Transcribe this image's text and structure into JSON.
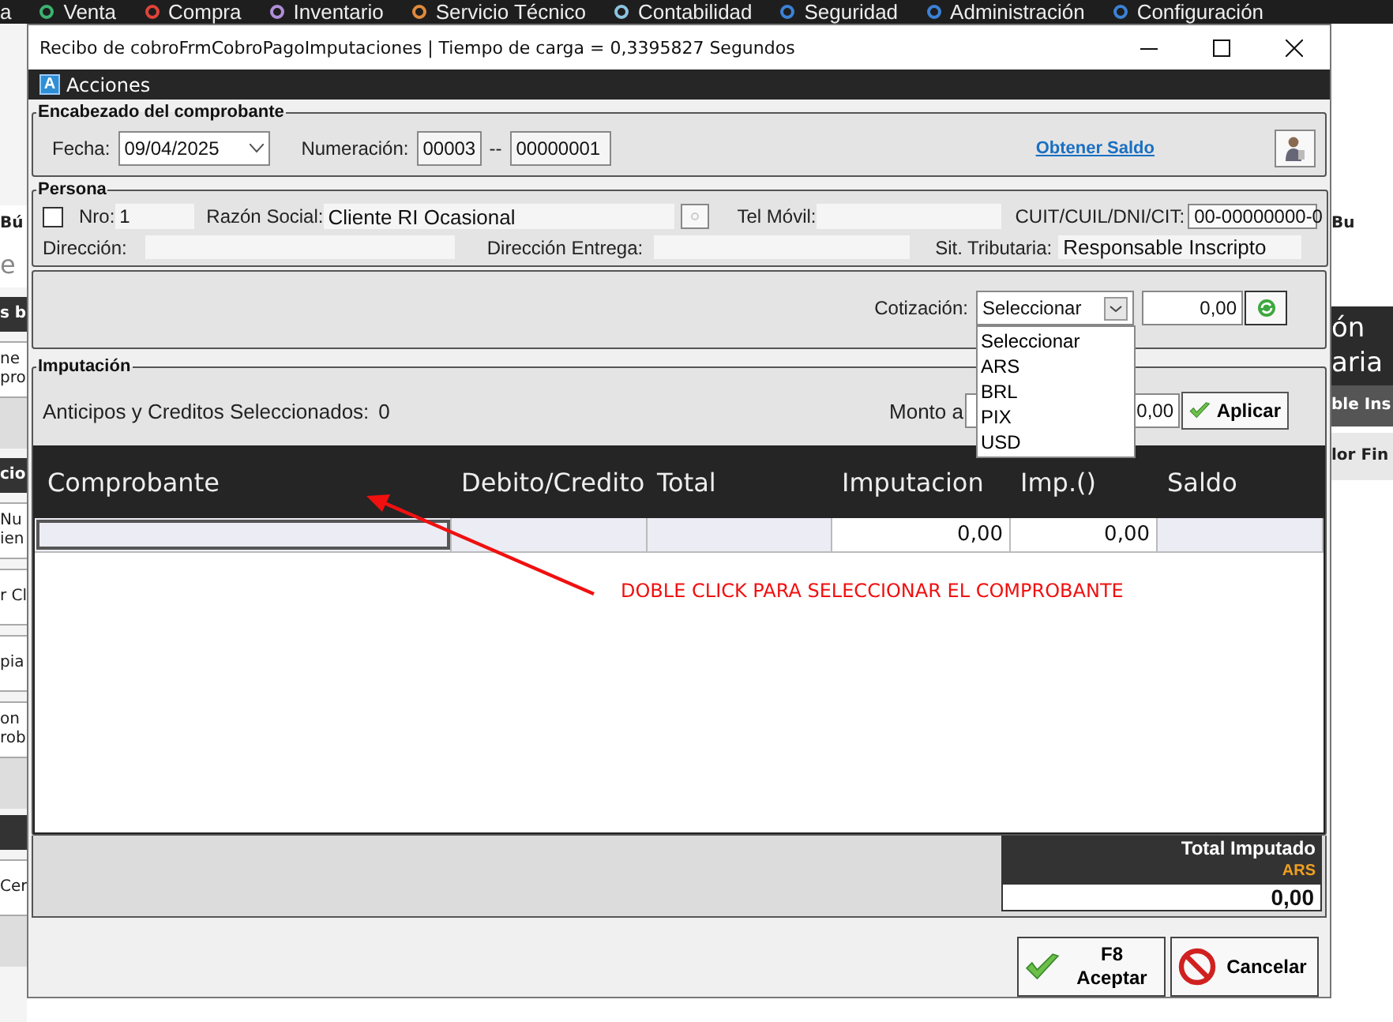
{
  "menu_bar": {
    "cut_label": "a",
    "items": [
      {
        "label": "Venta",
        "color": "#3cb371"
      },
      {
        "label": "Compra",
        "color": "#e0443a"
      },
      {
        "label": "Inventario",
        "color": "#b08fd8"
      },
      {
        "label": "Servicio Técnico",
        "color": "#e08a3c"
      },
      {
        "label": "Contabilidad",
        "color": "#8cc4e0"
      },
      {
        "label": "Seguridad",
        "color": "#3b82d6"
      },
      {
        "label": "Administración",
        "color": "#3b82d6"
      },
      {
        "label": "Configuración",
        "color": "#3b82d6"
      }
    ]
  },
  "background_left": [
    {
      "kind": "label",
      "lines": [
        "Bú"
      ]
    },
    {
      "kind": "input",
      "lines": [
        "e"
      ]
    },
    {
      "kind": "header",
      "lines": [
        "s b"
      ]
    },
    {
      "kind": "row",
      "lines": [
        "ne",
        "pro"
      ]
    },
    {
      "kind": "blank"
    },
    {
      "kind": "header",
      "lines": [
        "cio"
      ]
    },
    {
      "kind": "row",
      "lines": [
        "Nu",
        "ien"
      ]
    },
    {
      "kind": "row",
      "lines": [
        "r Cl"
      ]
    },
    {
      "kind": "row",
      "lines": [
        "pia"
      ]
    },
    {
      "kind": "row",
      "lines": [
        "on",
        "rob"
      ]
    },
    {
      "kind": "blank"
    },
    {
      "kind": "bar"
    },
    {
      "kind": "row",
      "lines": [
        "Cer"
      ]
    },
    {
      "kind": "blank"
    }
  ],
  "background_right": [
    {
      "kind": "label",
      "lines": [
        "Bu"
      ]
    },
    {
      "kind": "heading",
      "lines": [
        "ón",
        "aria"
      ]
    },
    {
      "kind": "header",
      "lines": [
        "ble Ins"
      ]
    },
    {
      "kind": "row",
      "lines": [
        "lor Fin"
      ]
    }
  ],
  "window": {
    "title": "Recibo de cobroFrmCobroPagoImputaciones | Tiempo de carga = 0,3395827 Segundos",
    "actions_icon": "A",
    "actions_label": "Acciones"
  },
  "encabezado": {
    "title": "Encabezado del comprobante",
    "fecha_label": "Fecha:",
    "fecha": "09/04/2025",
    "numeracion_label": "Numeración:",
    "punto_venta": "00003",
    "separator": "--",
    "numero": "00000001",
    "link": "Obtener Saldo"
  },
  "persona": {
    "title": "Persona",
    "checked": false,
    "nro_label": "Nro:",
    "nro": "1",
    "razon_social_label": "Razón Social:",
    "razon_social": "Cliente RI Ocasional",
    "tel_label": "Tel Móvil:",
    "cuit_label": "CUIT/CUIL/DNI/CIT:",
    "cuit": "00-00000000-0",
    "direccion_label": "Dirección:",
    "direccion_entrega_label": "Dirección Entrega:",
    "sit_label": "Sit. Tributaria:",
    "sit": "Responsable Inscripto"
  },
  "cotizacion": {
    "label": "Cotización:",
    "select_value": "Seleccionar",
    "expanded": true,
    "options": [
      "Seleccionar",
      "ARS",
      "BRL",
      "PIX",
      "USD"
    ],
    "amount": "0,00"
  },
  "imputacion": {
    "title": "Imputación",
    "anticipos_label": "Anticipos y Creditos Seleccionados:",
    "anticipos_count": "0",
    "monto_label": "Monto a",
    "monto": "0,00",
    "apply_button": "Aplicar"
  },
  "table": {
    "columns": [
      "Comprobante",
      "Debito/Credito",
      "Total",
      "Imputacion",
      "Imp.()",
      "Saldo"
    ],
    "rows": [
      {
        "imputacion": "0,00",
        "imp": "0,00"
      }
    ]
  },
  "annotation": "DOBLE CLICK PARA SELECCIONAR EL COMPROBANTE",
  "totals": {
    "label": "Total Imputado",
    "currency": "ARS",
    "value": "0,00"
  },
  "buttons": [
    {
      "kind": "accept",
      "key": "F8",
      "label": "Aceptar"
    },
    {
      "kind": "cancel",
      "label": "Cancelar"
    }
  ]
}
